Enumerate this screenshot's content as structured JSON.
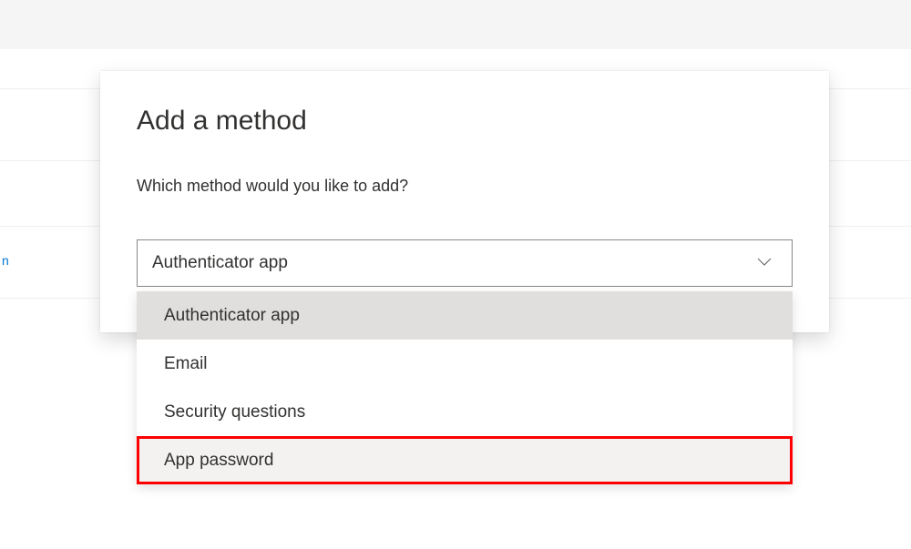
{
  "dialog": {
    "title": "Add a method",
    "question": "Which method would you like to add?",
    "selected_value": "Authenticator app"
  },
  "dropdown": {
    "options": [
      "Authenticator app",
      "Email",
      "Security questions",
      "App password"
    ]
  },
  "bg_hint": "n"
}
